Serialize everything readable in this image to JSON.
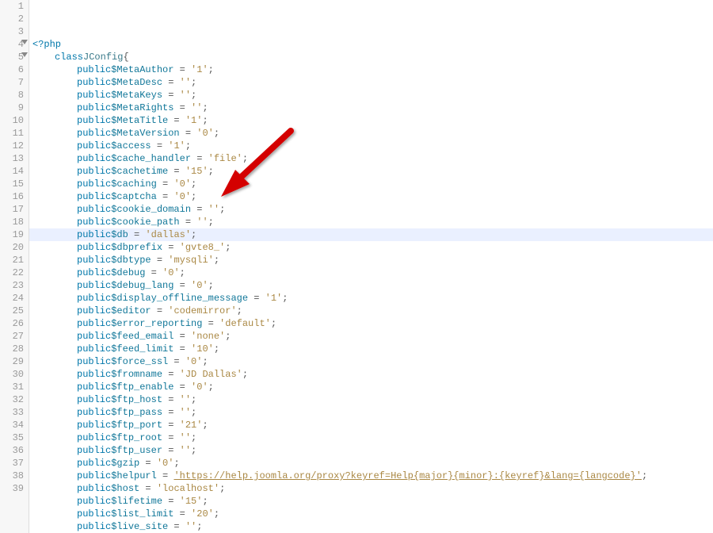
{
  "chart_data": null,
  "arrow": {
    "target_line": 16
  },
  "highlighted_line": 16,
  "code": {
    "open_tag": "<?php",
    "class_decl": {
      "kw_class": "class",
      "name": "JConfig",
      "brace": "{"
    },
    "props": [
      {
        "name": "$MetaAuthor",
        "value": "'1'"
      },
      {
        "name": "$MetaDesc",
        "value": "''"
      },
      {
        "name": "$MetaKeys",
        "value": "''"
      },
      {
        "name": "$MetaRights",
        "value": "''"
      },
      {
        "name": "$MetaTitle",
        "value": "'1'"
      },
      {
        "name": "$MetaVersion",
        "value": "'0'"
      },
      {
        "name": "$access",
        "value": "'1'"
      },
      {
        "name": "$cache_handler",
        "value": "'file'"
      },
      {
        "name": "$cachetime",
        "value": "'15'"
      },
      {
        "name": "$caching",
        "value": "'0'"
      },
      {
        "name": "$captcha",
        "value": "'0'"
      },
      {
        "name": "$cookie_domain",
        "value": "''"
      },
      {
        "name": "$cookie_path",
        "value": "''"
      },
      {
        "name": "$db",
        "value": "'dallas'"
      },
      {
        "name": "$dbprefix",
        "value": "'gvte8_'"
      },
      {
        "name": "$dbtype",
        "value": "'mysqli'"
      },
      {
        "name": "$debug",
        "value": "'0'"
      },
      {
        "name": "$debug_lang",
        "value": "'0'"
      },
      {
        "name": "$display_offline_message",
        "value": "'1'"
      },
      {
        "name": "$editor",
        "value": "'codemirror'"
      },
      {
        "name": "$error_reporting",
        "value": "'default'"
      },
      {
        "name": "$feed_email",
        "value": "'none'"
      },
      {
        "name": "$feed_limit",
        "value": "'10'"
      },
      {
        "name": "$force_ssl",
        "value": "'0'"
      },
      {
        "name": "$fromname",
        "value": "'JD Dallas'"
      },
      {
        "name": "$ftp_enable",
        "value": "'0'"
      },
      {
        "name": "$ftp_host",
        "value": "''"
      },
      {
        "name": "$ftp_pass",
        "value": "''"
      },
      {
        "name": "$ftp_port",
        "value": "'21'"
      },
      {
        "name": "$ftp_root",
        "value": "''"
      },
      {
        "name": "$ftp_user",
        "value": "''"
      },
      {
        "name": "$gzip",
        "value": "'0'"
      },
      {
        "name": "$helpurl",
        "value": "'https://help.joomla.org/proxy?keyref=Help{major}{minor}:{keyref}&lang={langcode}'",
        "underline": true
      },
      {
        "name": "$host",
        "value": "'localhost'"
      },
      {
        "name": "$lifetime",
        "value": "'15'"
      },
      {
        "name": "$list_limit",
        "value": "'20'"
      },
      {
        "name": "$live_site",
        "value": "''"
      }
    ],
    "modifier": "public",
    "eq": " = ",
    "semi": ";"
  },
  "line_count": 39
}
